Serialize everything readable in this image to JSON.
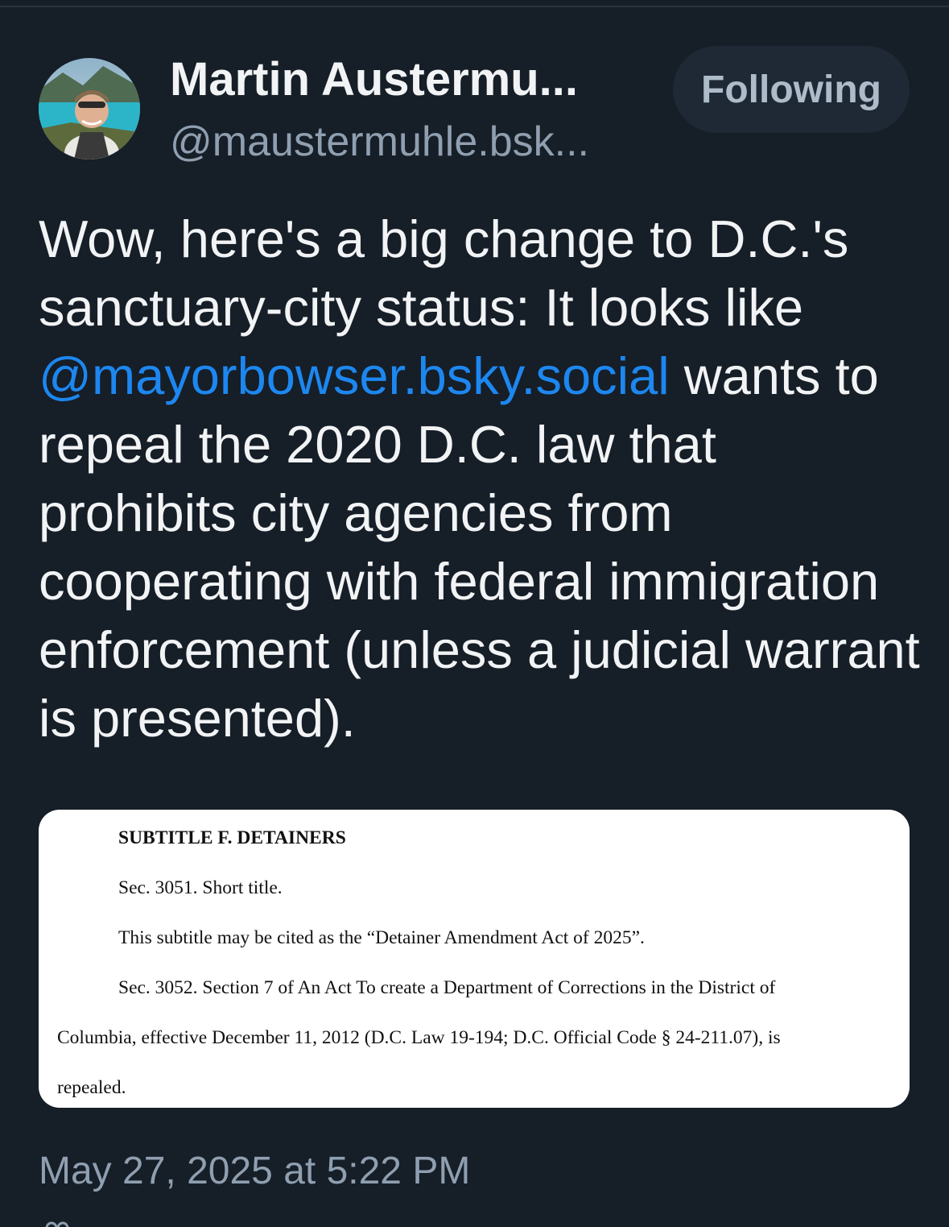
{
  "post": {
    "author": {
      "display_name": "Martin Austermu...",
      "handle": "@maustermuhle.bsk..."
    },
    "follow_button_label": "Following",
    "text_before_mention": "Wow, here's a big change to D.C.'s sanctuary-city status: It looks like ",
    "mention": "@mayorbowser.bsky.social",
    "text_after_mention": " wants to repeal the 2020 D.C. law that prohibits city agencies from cooperating with federal immigration enforcement (unless a judicial warrant is presented).",
    "embed": {
      "heading": "SUBTITLE F. DETAINERS",
      "lines": [
        "Sec. 3051. Short title.",
        "This subtitle may be cited as the “Detainer Amendment Act of 2025”.",
        "Sec. 3052. Section 7 of An Act To create a Department of Corrections in the District of",
        "Columbia, effective December 11, 2012 (D.C. Law 19-194; D.C. Official Code § 24-211.07), is",
        "repealed."
      ]
    },
    "timestamp": "May 27, 2025 at 5:22 PM"
  },
  "colors": {
    "background": "#161e27",
    "mention": "#1d87f0",
    "muted_text": "#8f9fb0",
    "button_bg": "#1e2935"
  },
  "icons": {
    "avatar": "profile-photo",
    "footer": "people-icon"
  }
}
